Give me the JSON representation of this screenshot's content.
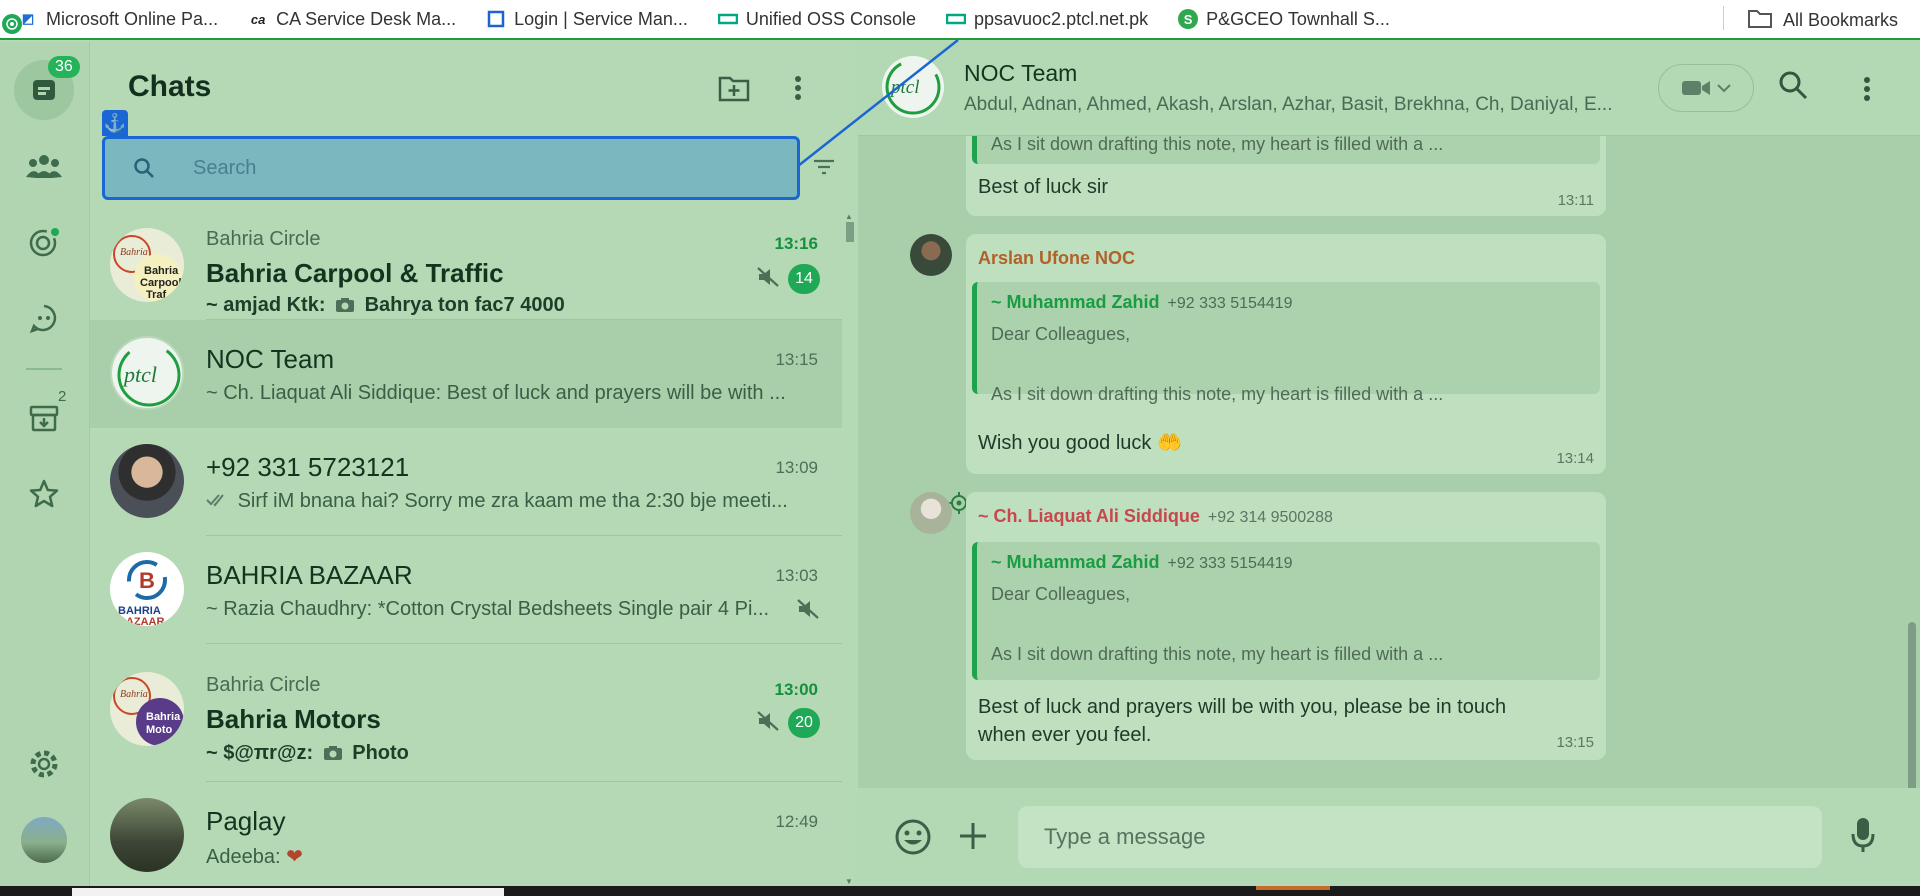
{
  "bookmarks": [
    {
      "label": "Microsoft Online Pa...",
      "icon": "microsoft-icon"
    },
    {
      "label": "CA Service Desk Ma...",
      "icon": "ca-icon"
    },
    {
      "label": "Login | Service Man...",
      "icon": "service-man-icon"
    },
    {
      "label": "Unified OSS Console",
      "icon": "hpe-icon"
    },
    {
      "label": "ppsavuoc2.ptcl.net.pk",
      "icon": "hpe-icon"
    },
    {
      "label": "P&GCEO Townhall S...",
      "icon": "s-icon"
    }
  ],
  "all_bookmarks": "All Bookmarks",
  "rail": {
    "unread_count": "36",
    "archived_count": "2"
  },
  "chats_panel": {
    "title": "Chats",
    "search_placeholder": "Search",
    "chats": [
      {
        "group": "Bahria Circle",
        "name": "Bahria Carpool & Traffic",
        "sender": "~ amjad Ktk:",
        "preview": "Bahrya ton fac7 4000",
        "time": "13:16",
        "unread": "14",
        "muted": true,
        "avatar_text": "Bahria Carpool Traf"
      },
      {
        "group": "",
        "name": "NOC Team",
        "sender": "",
        "preview": "~ Ch. Liaquat Ali Siddique: Best of luck and prayers will be with ...",
        "time": "13:15",
        "unread": "",
        "muted": false,
        "avatar_text": "ptcl"
      },
      {
        "group": "",
        "name": "+92 331 5723121",
        "sender": "",
        "preview": "Sirf iM bnana hai? Sorry me zra kaam me tha 2:30 bje meeti...",
        "time": "13:09",
        "unread": "",
        "muted": false,
        "avatar_text": ""
      },
      {
        "group": "",
        "name": "BAHRIA BAZAAR",
        "sender": "",
        "preview": "~ Razia Chaudhry: *Cotton Crystal Bedsheets Single pair 4 Pi...",
        "time": "13:03",
        "unread": "",
        "muted": true,
        "avatar_text": "BAHRIA BAZAAR"
      },
      {
        "group": "Bahria Circle",
        "name": "Bahria Motors",
        "sender": "~ $@πr@z:",
        "preview": "Photo",
        "time": "13:00",
        "unread": "20",
        "muted": true,
        "avatar_text": "Bahria Moto"
      },
      {
        "group": "",
        "name": "Paglay",
        "sender": "",
        "preview": "Adeeba: ",
        "time": "12:49",
        "unread": "",
        "muted": false,
        "avatar_text": ""
      }
    ]
  },
  "conversation": {
    "name": "NOC Team",
    "members": "Abdul, Adnan, Ahmed, Akash, Arslan, Azhar, Basit, Brekhna, Ch, Daniyal, E...",
    "messages": [
      {
        "quote_tail": "As I sit down drafting this note, my heart is filled with a ...",
        "text": "Best of luck sir",
        "time": "13:11"
      },
      {
        "sender": "Arslan Ufone NOC",
        "quote_author": "~ Muhammad Zahid",
        "quote_phone": "+92 333 5154419",
        "quote_line1": "Dear Colleagues,",
        "quote_line2": "As I sit down drafting this note, my heart is filled with a ...",
        "text": "Wish you good luck 🤲",
        "time": "13:14"
      },
      {
        "sender": "~ Ch. Liaquat Ali Siddique",
        "sender_phone": "+92 314 9500288",
        "quote_author": "~ Muhammad Zahid",
        "quote_phone": "+92 333 5154419",
        "quote_line1": "Dear Colleagues,",
        "quote_line2": "As I sit down drafting this note, my heart is filled with a ...",
        "text_line1": "Best of luck and prayers will be with you, please be in touch",
        "text_line2": "when ever you feel.",
        "time": "13:15"
      }
    ],
    "composer_placeholder": "Type a message"
  },
  "colors": {
    "accent_green": "#1fa855",
    "sender_orange": "#b0622a",
    "sender_red": "#c8474f",
    "search_border": "#1a66d4"
  }
}
